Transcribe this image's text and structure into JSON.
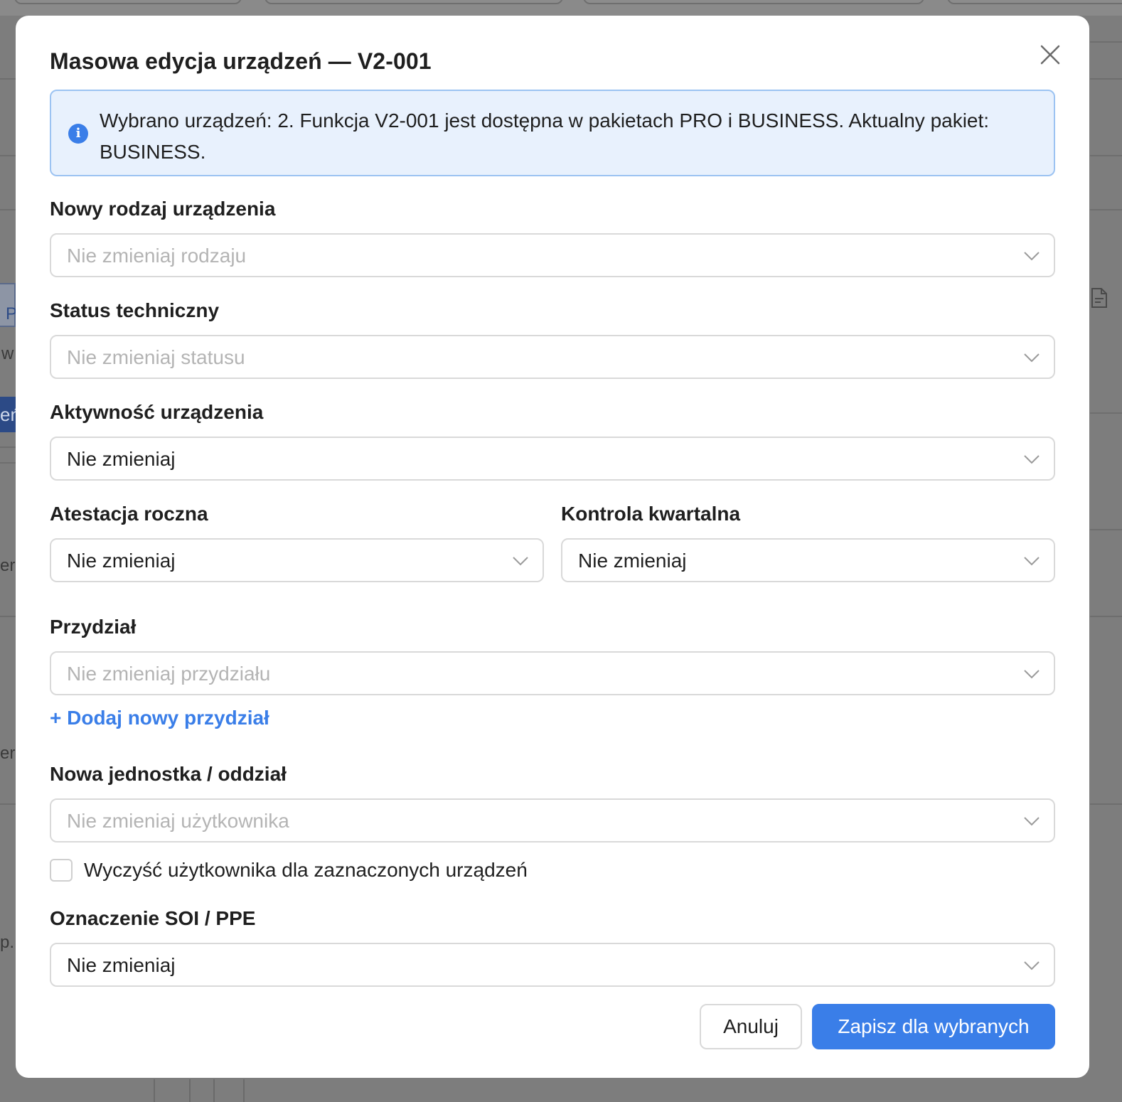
{
  "modal": {
    "title": "Masowa edycja urządzeń — V2-001",
    "info_text": "Wybrano urządzeń: 2. Funkcja V2-001 jest dostępna w pakietach PRO i BUSINESS. Aktualny pakiet: BUSINESS.",
    "info_icon_glyph": "i"
  },
  "fields": {
    "device_type": {
      "label": "Nowy rodzaj urządzenia",
      "placeholder": "Nie zmieniaj rodzaju"
    },
    "tech_status": {
      "label": "Status techniczny",
      "placeholder": "Nie zmieniaj statusu"
    },
    "activity": {
      "label": "Aktywność urządzenia",
      "value": "Nie zmieniaj"
    },
    "annual_attestation": {
      "label": "Atestacja roczna",
      "value": "Nie zmieniaj"
    },
    "quarterly_control": {
      "label": "Kontrola kwartalna",
      "value": "Nie zmieniaj"
    },
    "assignment": {
      "label": "Przydział",
      "placeholder": "Nie zmieniaj przydziału",
      "add_link": "+ Dodaj nowy przydział"
    },
    "unit": {
      "label": "Nowa jednostka / oddział",
      "placeholder": "Nie zmieniaj użytkownika"
    },
    "clear_user_checkbox": {
      "label": "Wyczyść użytkownika dla zaznaczonych urządzeń",
      "checked": false
    },
    "soi_ppe": {
      "label": "Oznaczenie SOI / PPE",
      "value": "Nie zmieniaj"
    }
  },
  "buttons": {
    "cancel": "Anuluj",
    "save": "Zapisz dla wybranych"
  },
  "background": {
    "fragments": [
      "P",
      "w",
      "eń",
      "er",
      "er",
      "p."
    ]
  },
  "colors": {
    "accent": "#3a7ee8",
    "info_bg": "#e8f1fd",
    "info_border": "#9cc3f2",
    "placeholder": "#b4b4b4"
  },
  "icons": {
    "close": "close-icon",
    "info": "info-icon",
    "chevron": "chevron-down-icon",
    "document": "document-icon"
  }
}
